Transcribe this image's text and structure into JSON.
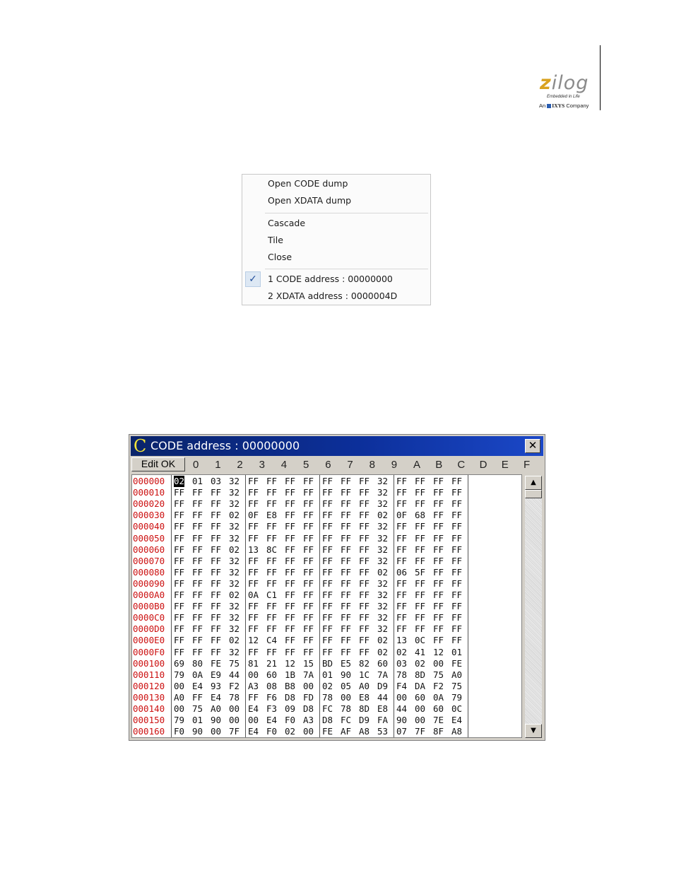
{
  "logo": {
    "word_first": "z",
    "word_rest": "ilog",
    "tagline": "Embedded in Life",
    "company_prefix": "An",
    "company_name": "IXYS",
    "company_suffix": "Company"
  },
  "menu": {
    "items": [
      {
        "label": "Open CODE dump"
      },
      {
        "label": "Open XDATA dump"
      },
      {
        "label": "Cascade"
      },
      {
        "label": "Tile"
      },
      {
        "label": "Close"
      },
      {
        "label": "1 CODE address : 00000000",
        "checked": true
      },
      {
        "label": "2 XDATA address : 0000004D",
        "checked": false
      }
    ],
    "check_glyph": "✓"
  },
  "window": {
    "icon_letter": "C",
    "title": "CODE address : 00000000",
    "close_glyph": "✕",
    "edit_button": "Edit OK",
    "columns": [
      "0",
      "1",
      "2",
      "3",
      "4",
      "5",
      "6",
      "7",
      "8",
      "9",
      "A",
      "B",
      "C",
      "D",
      "E",
      "F"
    ],
    "scroll_up": "▲",
    "scroll_down": "▼",
    "rows": [
      {
        "addr": "000000",
        "bytes": [
          "02",
          "01",
          "03",
          "32",
          "FF",
          "FF",
          "FF",
          "FF",
          "FF",
          "FF",
          "FF",
          "32",
          "FF",
          "FF",
          "FF",
          "FF"
        ]
      },
      {
        "addr": "000010",
        "bytes": [
          "FF",
          "FF",
          "FF",
          "32",
          "FF",
          "FF",
          "FF",
          "FF",
          "FF",
          "FF",
          "FF",
          "32",
          "FF",
          "FF",
          "FF",
          "FF"
        ]
      },
      {
        "addr": "000020",
        "bytes": [
          "FF",
          "FF",
          "FF",
          "32",
          "FF",
          "FF",
          "FF",
          "FF",
          "FF",
          "FF",
          "FF",
          "32",
          "FF",
          "FF",
          "FF",
          "FF"
        ]
      },
      {
        "addr": "000030",
        "bytes": [
          "FF",
          "FF",
          "FF",
          "02",
          "0F",
          "E8",
          "FF",
          "FF",
          "FF",
          "FF",
          "FF",
          "02",
          "0F",
          "68",
          "FF",
          "FF"
        ]
      },
      {
        "addr": "000040",
        "bytes": [
          "FF",
          "FF",
          "FF",
          "32",
          "FF",
          "FF",
          "FF",
          "FF",
          "FF",
          "FF",
          "FF",
          "32",
          "FF",
          "FF",
          "FF",
          "FF"
        ]
      },
      {
        "addr": "000050",
        "bytes": [
          "FF",
          "FF",
          "FF",
          "32",
          "FF",
          "FF",
          "FF",
          "FF",
          "FF",
          "FF",
          "FF",
          "32",
          "FF",
          "FF",
          "FF",
          "FF"
        ]
      },
      {
        "addr": "000060",
        "bytes": [
          "FF",
          "FF",
          "FF",
          "02",
          "13",
          "8C",
          "FF",
          "FF",
          "FF",
          "FF",
          "FF",
          "32",
          "FF",
          "FF",
          "FF",
          "FF"
        ]
      },
      {
        "addr": "000070",
        "bytes": [
          "FF",
          "FF",
          "FF",
          "32",
          "FF",
          "FF",
          "FF",
          "FF",
          "FF",
          "FF",
          "FF",
          "32",
          "FF",
          "FF",
          "FF",
          "FF"
        ]
      },
      {
        "addr": "000080",
        "bytes": [
          "FF",
          "FF",
          "FF",
          "32",
          "FF",
          "FF",
          "FF",
          "FF",
          "FF",
          "FF",
          "FF",
          "02",
          "06",
          "5F",
          "FF",
          "FF"
        ]
      },
      {
        "addr": "000090",
        "bytes": [
          "FF",
          "FF",
          "FF",
          "32",
          "FF",
          "FF",
          "FF",
          "FF",
          "FF",
          "FF",
          "FF",
          "32",
          "FF",
          "FF",
          "FF",
          "FF"
        ]
      },
      {
        "addr": "0000A0",
        "bytes": [
          "FF",
          "FF",
          "FF",
          "02",
          "0A",
          "C1",
          "FF",
          "FF",
          "FF",
          "FF",
          "FF",
          "32",
          "FF",
          "FF",
          "FF",
          "FF"
        ]
      },
      {
        "addr": "0000B0",
        "bytes": [
          "FF",
          "FF",
          "FF",
          "32",
          "FF",
          "FF",
          "FF",
          "FF",
          "FF",
          "FF",
          "FF",
          "32",
          "FF",
          "FF",
          "FF",
          "FF"
        ]
      },
      {
        "addr": "0000C0",
        "bytes": [
          "FF",
          "FF",
          "FF",
          "32",
          "FF",
          "FF",
          "FF",
          "FF",
          "FF",
          "FF",
          "FF",
          "32",
          "FF",
          "FF",
          "FF",
          "FF"
        ]
      },
      {
        "addr": "0000D0",
        "bytes": [
          "FF",
          "FF",
          "FF",
          "32",
          "FF",
          "FF",
          "FF",
          "FF",
          "FF",
          "FF",
          "FF",
          "32",
          "FF",
          "FF",
          "FF",
          "FF"
        ]
      },
      {
        "addr": "0000E0",
        "bytes": [
          "FF",
          "FF",
          "FF",
          "02",
          "12",
          "C4",
          "FF",
          "FF",
          "FF",
          "FF",
          "FF",
          "02",
          "13",
          "0C",
          "FF",
          "FF"
        ]
      },
      {
        "addr": "0000F0",
        "bytes": [
          "FF",
          "FF",
          "FF",
          "32",
          "FF",
          "FF",
          "FF",
          "FF",
          "FF",
          "FF",
          "FF",
          "02",
          "02",
          "41",
          "12",
          "01"
        ]
      },
      {
        "addr": "000100",
        "bytes": [
          "69",
          "80",
          "FE",
          "75",
          "81",
          "21",
          "12",
          "15",
          "BD",
          "E5",
          "82",
          "60",
          "03",
          "02",
          "00",
          "FE"
        ]
      },
      {
        "addr": "000110",
        "bytes": [
          "79",
          "0A",
          "E9",
          "44",
          "00",
          "60",
          "1B",
          "7A",
          "01",
          "90",
          "1C",
          "7A",
          "78",
          "8D",
          "75",
          "A0"
        ]
      },
      {
        "addr": "000120",
        "bytes": [
          "00",
          "E4",
          "93",
          "F2",
          "A3",
          "08",
          "B8",
          "00",
          "02",
          "05",
          "A0",
          "D9",
          "F4",
          "DA",
          "F2",
          "75"
        ]
      },
      {
        "addr": "000130",
        "bytes": [
          "A0",
          "FF",
          "E4",
          "78",
          "FF",
          "F6",
          "D8",
          "FD",
          "78",
          "00",
          "E8",
          "44",
          "00",
          "60",
          "0A",
          "79"
        ]
      },
      {
        "addr": "000140",
        "bytes": [
          "00",
          "75",
          "A0",
          "00",
          "E4",
          "F3",
          "09",
          "D8",
          "FC",
          "78",
          "8D",
          "E8",
          "44",
          "00",
          "60",
          "0C"
        ]
      },
      {
        "addr": "000150",
        "bytes": [
          "79",
          "01",
          "90",
          "00",
          "00",
          "E4",
          "F0",
          "A3",
          "D8",
          "FC",
          "D9",
          "FA",
          "90",
          "00",
          "7E",
          "E4"
        ]
      },
      {
        "addr": "000160",
        "bytes": [
          "F0",
          "90",
          "00",
          "7F",
          "E4",
          "F0",
          "02",
          "00",
          "FE",
          "AF",
          "A8",
          "53",
          "07",
          "7F",
          "8F",
          "A8"
        ]
      }
    ]
  }
}
